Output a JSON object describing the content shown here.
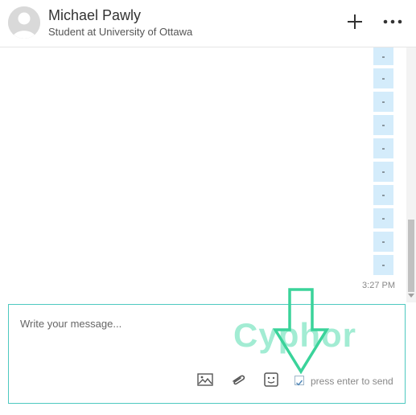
{
  "header": {
    "contact_name": "Michael Pawly",
    "contact_subtitle": "Student at University of Ottawa",
    "icons": {
      "avatar": "user-avatar",
      "add": "plus-icon",
      "more": "more-horizontal-icon"
    }
  },
  "thread": {
    "bubbles": [
      "-",
      "-",
      "-",
      "-",
      "-",
      "-",
      "-",
      "-",
      "-",
      "-"
    ],
    "timestamp": "3:27 PM"
  },
  "composer": {
    "placeholder": "Write your message...",
    "send_on_enter_label": "press enter to send",
    "send_on_enter_checked": true,
    "icons": [
      "image-icon",
      "paperclip-icon",
      "emoji-icon"
    ]
  },
  "watermark": {
    "text": "Cyphor"
  },
  "colors": {
    "bubble": "#d4ecfb",
    "composer_border": "#4ec9c0",
    "watermark": "#33d6a0",
    "arrow": "#3ad39a"
  }
}
